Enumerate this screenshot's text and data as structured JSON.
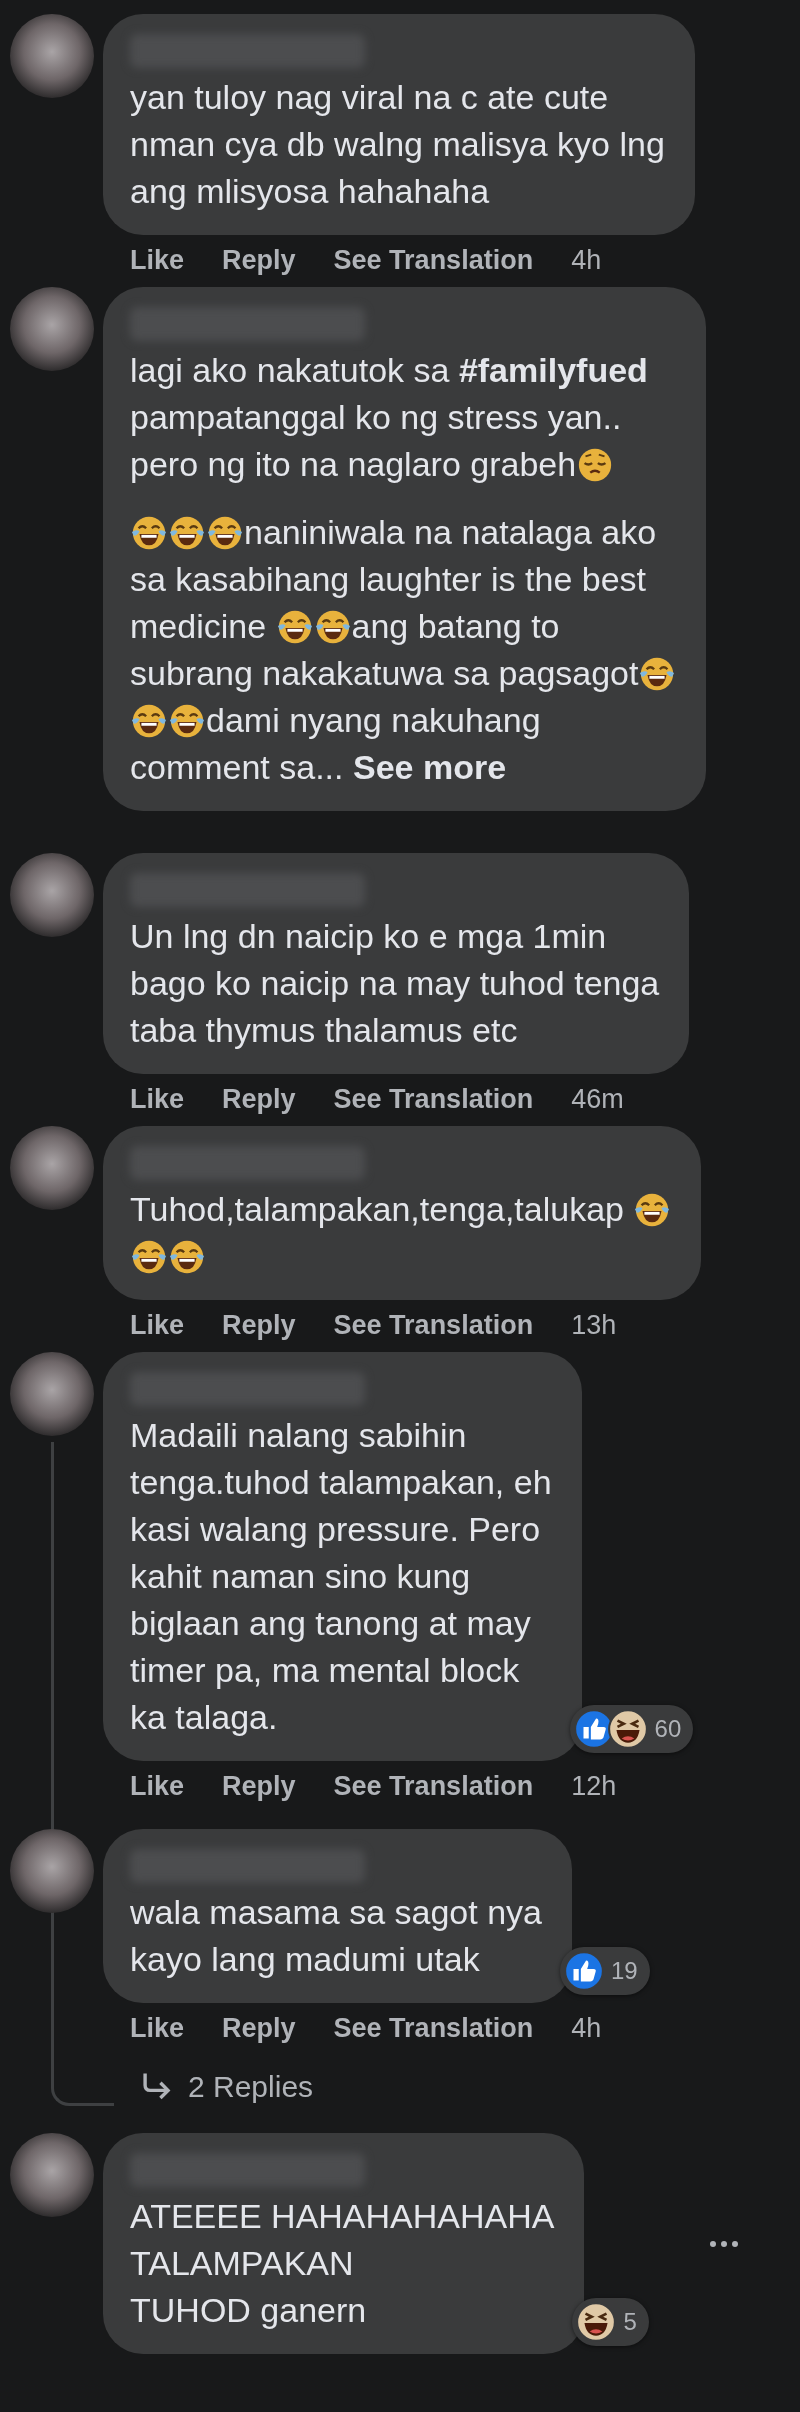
{
  "comments": [
    {
      "paragraphs": [
        [
          {
            "kind": "text",
            "text": "yan tuloy nag viral na c ate cute"
          },
          {
            "kind": "break"
          },
          {
            "kind": "text",
            "text": "nman cya db walng malisya kyo lng"
          },
          {
            "kind": "break"
          },
          {
            "kind": "text",
            "text": "ang mlisyosa hahahaha"
          }
        ]
      ],
      "actions": [
        {
          "kind": "link",
          "text": "Like"
        },
        {
          "kind": "link",
          "text": "Reply"
        },
        {
          "kind": "link",
          "text": "See Translation"
        },
        {
          "kind": "time",
          "text": "4h"
        }
      ]
    },
    {
      "paragraphs": [
        [
          {
            "kind": "text",
            "text": "lagi ako nakatutok sa **#familyfued**"
          },
          {
            "kind": "break"
          },
          {
            "kind": "text",
            "text": "pampatanggal ko ng stress yan.."
          },
          {
            "kind": "break"
          },
          {
            "kind": "text",
            "text": "pero ng ito na naglaro grabeh"
          },
          {
            "kind": "pensive"
          }
        ],
        [
          {
            "kind": "laugh"
          },
          {
            "kind": "laugh"
          },
          {
            "kind": "laugh"
          },
          {
            "kind": "text",
            "text": "naniniwala na natalaga ako"
          },
          {
            "kind": "break"
          },
          {
            "kind": "text",
            "text": "sa kasabihang laughter is the best"
          },
          {
            "kind": "break"
          },
          {
            "kind": "text",
            "text": "medicine "
          },
          {
            "kind": "laugh"
          },
          {
            "kind": "laugh"
          },
          {
            "kind": "text",
            "text": "ang batang to"
          },
          {
            "kind": "break"
          },
          {
            "kind": "text",
            "text": "subrang nakakatuwa sa pagsagot"
          },
          {
            "kind": "laugh"
          },
          {
            "kind": "break"
          },
          {
            "kind": "laugh"
          },
          {
            "kind": "laugh"
          },
          {
            "kind": "text",
            "text": "dami nyang nakuhang"
          },
          {
            "kind": "break"
          },
          {
            "kind": "text",
            "text": "comment sa... "
          },
          {
            "kind": "link",
            "text": "See more"
          }
        ]
      ]
    },
    {
      "paragraphs": [
        [
          {
            "kind": "text",
            "text": "Un lng dn naicip ko e mga 1min"
          },
          {
            "kind": "break"
          },
          {
            "kind": "text",
            "text": "bago ko naicip na may tuhod tenga"
          },
          {
            "kind": "break"
          },
          {
            "kind": "text",
            "text": "taba thymus thalamus etc"
          }
        ]
      ],
      "actions": [
        {
          "kind": "link",
          "text": "Like"
        },
        {
          "kind": "link",
          "text": "Reply"
        },
        {
          "kind": "link",
          "text": "See Translation"
        },
        {
          "kind": "time",
          "text": "46m"
        }
      ]
    },
    {
      "paragraphs": [
        [
          {
            "kind": "text",
            "text": "Tuhod,talampakan,tenga,talukap "
          },
          {
            "kind": "laugh"
          },
          {
            "kind": "break"
          },
          {
            "kind": "laugh"
          },
          {
            "kind": "laugh"
          }
        ]
      ],
      "actions": [
        {
          "kind": "link",
          "text": "Like"
        },
        {
          "kind": "link",
          "text": "Reply"
        },
        {
          "kind": "link",
          "text": "See Translation"
        },
        {
          "kind": "time",
          "text": "13h"
        }
      ]
    },
    {
      "paragraphs": [
        [
          {
            "kind": "text",
            "text": "Madaili nalang sabihin"
          },
          {
            "kind": "break"
          },
          {
            "kind": "text",
            "text": "tenga.tuhod talampakan, eh"
          },
          {
            "kind": "break"
          },
          {
            "kind": "text",
            "text": "kasi walang pressure. Pero"
          },
          {
            "kind": "break"
          },
          {
            "kind": "text",
            "text": "kahit naman sino kung"
          },
          {
            "kind": "break"
          },
          {
            "kind": "text",
            "text": "biglaan ang tanong at may"
          },
          {
            "kind": "break"
          },
          {
            "kind": "text",
            "text": "timer pa, ma mental block"
          },
          {
            "kind": "break"
          },
          {
            "kind": "text",
            "text": "ka talaga."
          }
        ]
      ],
      "reactions": {
        "types": [
          {
            "kind": "like"
          },
          {
            "kind": "haha"
          }
        ],
        "count": "60"
      },
      "actions": [
        {
          "kind": "link",
          "text": "Like"
        },
        {
          "kind": "link",
          "text": "Reply"
        },
        {
          "kind": "link",
          "text": "See Translation"
        },
        {
          "kind": "time",
          "text": "12h"
        }
      ],
      "replies": [
        {
          "paragraphs": [
            [
              {
                "kind": "text",
                "text": "wala masama sa sagot nya"
              },
              {
                "kind": "break"
              },
              {
                "kind": "text",
                "text": "kayo lang madumi utak"
              }
            ]
          ],
          "reactions": {
            "types": [
              {
                "kind": "like"
              }
            ],
            "count": "19"
          },
          "actions": [
            {
              "kind": "link",
              "text": "Like"
            },
            {
              "kind": "link",
              "text": "Reply"
            },
            {
              "kind": "link",
              "text": "See Translation"
            },
            {
              "kind": "time",
              "text": "4h"
            }
          ]
        }
      ],
      "more_replies": "2 Replies"
    },
    {
      "paragraphs": [
        [
          {
            "kind": "text",
            "text": "ATEEEE HAHAHAHAHAHA"
          },
          {
            "kind": "break"
          },
          {
            "kind": "text",
            "text": "TALAMPAKAN"
          },
          {
            "kind": "break"
          },
          {
            "kind": "text",
            "text": "TUHOD ganern"
          }
        ]
      ],
      "reactions": {
        "types": [
          {
            "kind": "haha"
          }
        ],
        "count": "5"
      },
      "has_menu": true
    }
  ]
}
